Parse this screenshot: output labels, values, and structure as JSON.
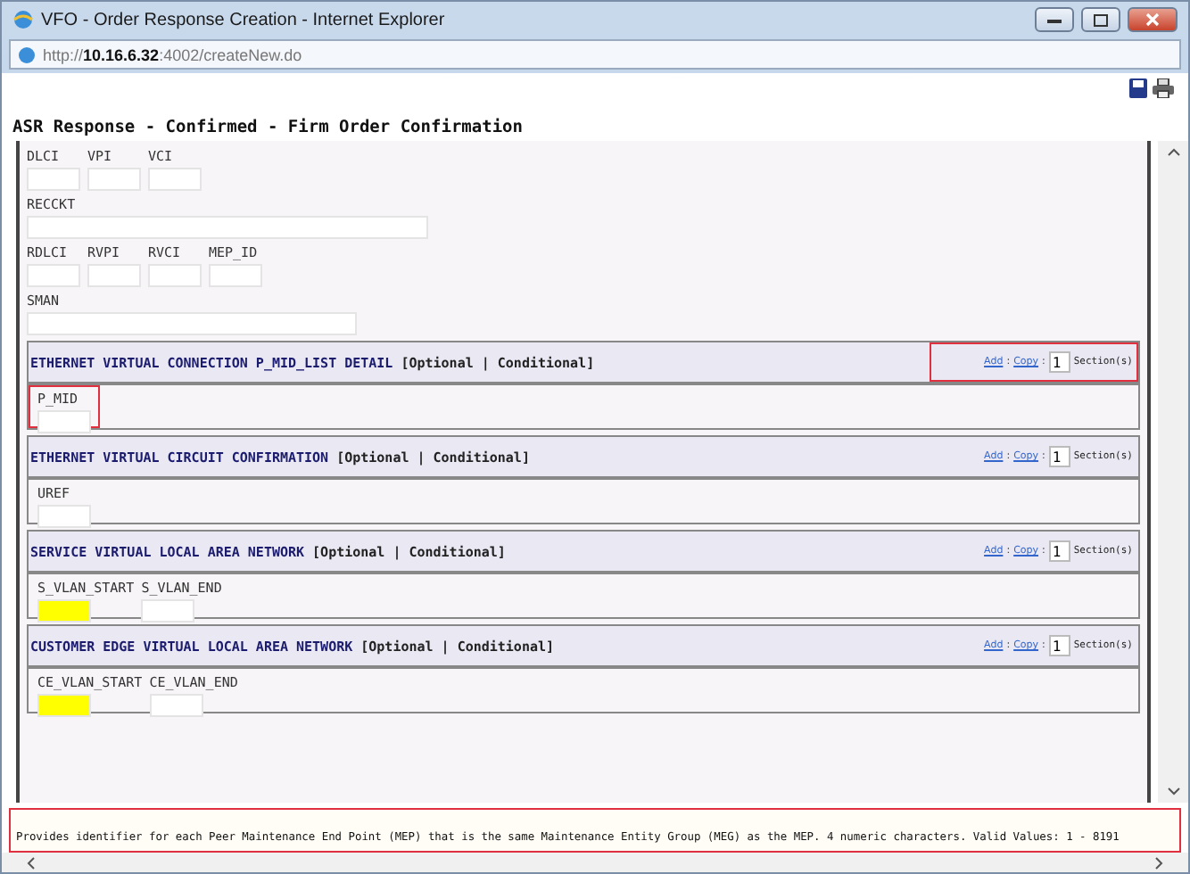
{
  "window": {
    "title": "VFO - Order Response Creation - Internet Explorer"
  },
  "address": "http://**10.16.6.32**:4002/createNew.do",
  "heading": "ASR Response - Confirmed - Firm Order Confirmation",
  "field_rows": [
    [
      {
        "label": "DLCI",
        "kind": "short"
      },
      {
        "label": "VPI",
        "kind": "short"
      },
      {
        "label": "VCI",
        "kind": "short"
      }
    ],
    [
      {
        "label": "RECCKT",
        "kind": "long"
      }
    ],
    [
      {
        "label": "RDLCI",
        "kind": "short"
      },
      {
        "label": "RVPI",
        "kind": "short"
      },
      {
        "label": "RVCI",
        "kind": "short"
      },
      {
        "label": "MEP_ID",
        "kind": "short"
      }
    ],
    [
      {
        "label": "SMAN",
        "kind": "medium"
      }
    ]
  ],
  "sections": [
    {
      "title": "ETHERNET VIRTUAL CONNECTION P_MID_LIST DETAIL",
      "qualifier": "[Optional | Conditional]",
      "add": "Add",
      "sep": ":",
      "copy": "Copy",
      "count": "1",
      "suffix": "Section(s)",
      "controls_outlined": true,
      "fields_outlined": true,
      "fields": [
        {
          "label": "P_MID",
          "required": false
        }
      ]
    },
    {
      "title": "ETHERNET VIRTUAL CIRCUIT CONFIRMATION",
      "qualifier": "[Optional | Conditional]",
      "add": "Add",
      "sep": ":",
      "copy": "Copy",
      "count": "1",
      "suffix": "Section(s)",
      "controls_outlined": false,
      "fields_outlined": false,
      "fields": [
        {
          "label": "UREF",
          "required": false
        }
      ]
    },
    {
      "title": "SERVICE VIRTUAL LOCAL AREA NETWORK",
      "qualifier": "[Optional | Conditional]",
      "add": "Add",
      "sep": ":",
      "copy": "Copy",
      "count": "1",
      "suffix": "Section(s)",
      "controls_outlined": false,
      "fields_outlined": false,
      "fields": [
        {
          "label": "S_VLAN_START",
          "required": true
        },
        {
          "label": "S_VLAN_END",
          "required": false
        }
      ]
    },
    {
      "title": "CUSTOMER EDGE VIRTUAL LOCAL AREA NETWORK",
      "qualifier": "[Optional | Conditional]",
      "add": "Add",
      "sep": ":",
      "copy": "Copy",
      "count": "1",
      "suffix": "Section(s)",
      "controls_outlined": false,
      "fields_outlined": false,
      "fields": [
        {
          "label": "CE_VLAN_START",
          "required": true
        },
        {
          "label": "CE_VLAN_END",
          "required": false
        }
      ]
    }
  ],
  "help": {
    "text": "Provides identifier for each Peer Maintenance End Point (MEP) that is the same Maintenance Entity Group (MEG) as the MEP. 4 numeric characters. Valid Values: 1 - 8191",
    "outlined": true
  }
}
